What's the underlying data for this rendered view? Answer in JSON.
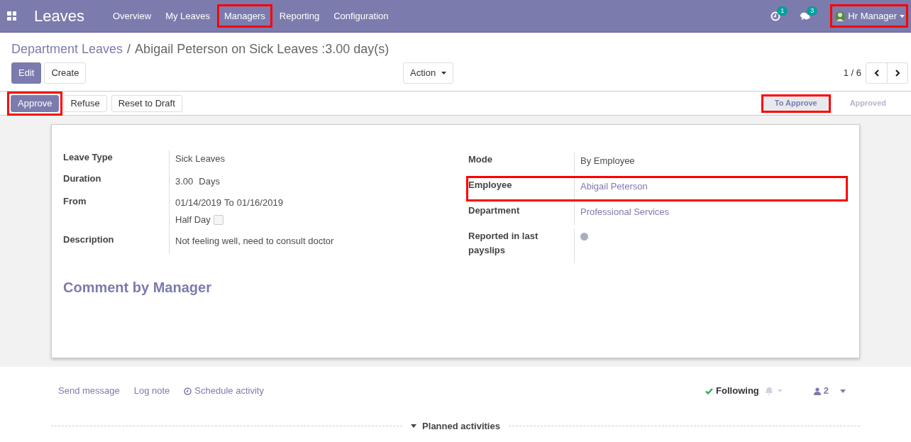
{
  "navbar": {
    "app_title": "Leaves",
    "menu": [
      {
        "label": "Overview",
        "highlighted": false
      },
      {
        "label": "My Leaves",
        "highlighted": false
      },
      {
        "label": "Managers",
        "highlighted": true
      },
      {
        "label": "Reporting",
        "highlighted": false
      },
      {
        "label": "Configuration",
        "highlighted": false
      }
    ],
    "activity_count": "1",
    "message_count": "3",
    "user": {
      "name": "Hr Manager",
      "highlighted": true
    }
  },
  "breadcrumb": {
    "parent": "Department Leaves",
    "separator": "/",
    "current": "Abigail Peterson on Sick Leaves :3.00 day(s)"
  },
  "buttons": [
    {
      "label": "Edit",
      "primary": true
    },
    {
      "label": "Create",
      "primary": false
    }
  ],
  "action": "Action",
  "pager": "1 / 6",
  "workflow_buttons": [
    {
      "label": "Approve",
      "primary": true,
      "highlighted": true
    },
    {
      "label": "Refuse",
      "primary": false,
      "highlighted": false
    },
    {
      "label": "Reset to Draft",
      "primary": false,
      "highlighted": false
    }
  ],
  "statusbar": [
    {
      "label": "To Approve",
      "selected": true,
      "highlighted": true
    },
    {
      "label": "Approved",
      "selected": false,
      "highlighted": false
    }
  ],
  "left_fields": [
    {
      "label": "Leave Type",
      "kind": "text",
      "value": "Sick Leaves"
    },
    {
      "label": "Duration",
      "kind": "duration",
      "value": "3.00",
      "unit": "Days"
    },
    {
      "label": "From",
      "kind": "daterange",
      "start": "01/14/2019",
      "to": "To",
      "end": "01/16/2019",
      "half_day_label": "Half Day",
      "half_day_checked": false
    },
    {
      "label": "Description",
      "kind": "text",
      "value": "Not feeling well, need to consult doctor"
    }
  ],
  "right_fields": [
    {
      "label": "Mode",
      "kind": "text",
      "value": "By Employee",
      "highlighted": false
    },
    {
      "label": "Employee",
      "kind": "link",
      "value": "Abigail Peterson",
      "highlighted": true
    },
    {
      "label": "Department",
      "kind": "link",
      "value": "Professional Services",
      "highlighted": false
    },
    {
      "label": "Reported in last payslips",
      "kind": "toggle",
      "on": false,
      "highlighted": false
    }
  ],
  "comment_heading": "Comment by Manager",
  "chatter": {
    "send_message": "Send message",
    "log_note": "Log note",
    "schedule_activity": "Schedule activity",
    "following": "Following",
    "followers": "2",
    "planned_activities": "Planned activities"
  }
}
